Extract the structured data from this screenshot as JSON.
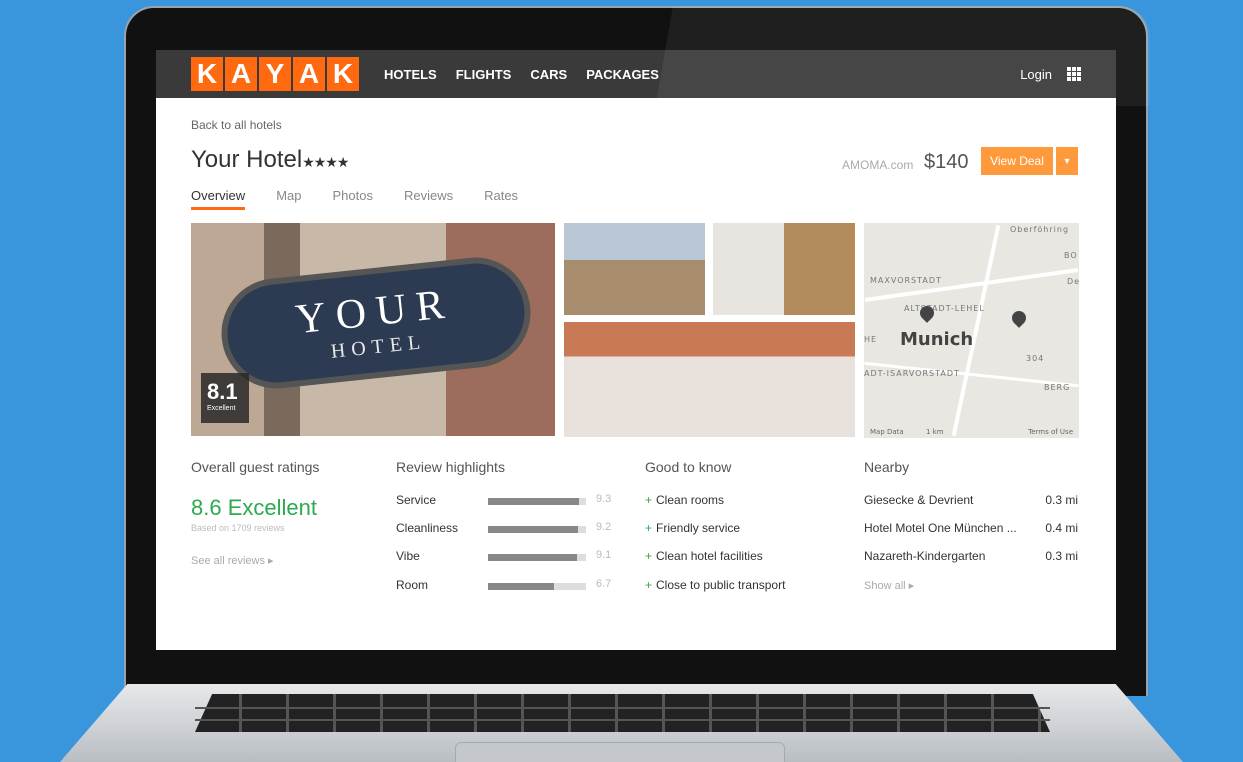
{
  "header": {
    "logo_letters": [
      "K",
      "A",
      "Y",
      "A",
      "K"
    ],
    "nav": [
      "HOTELS",
      "FLIGHTS",
      "CARS",
      "PACKAGES"
    ],
    "login": "Login"
  },
  "hotel": {
    "back_link": "Back to all hotels",
    "name": "Your Hotel",
    "stars": "★★★★",
    "provider": "AMOMA.com",
    "price": "$140",
    "deal_label": "View Deal",
    "deal_arrow": "▾"
  },
  "tabs": [
    "Overview",
    "Map",
    "Photos",
    "Reviews",
    "Rates"
  ],
  "photo": {
    "sign_top": "YOUR",
    "sign_bottom": "HOTEL",
    "score": "8.1",
    "score_label": "Excellent"
  },
  "map": {
    "labels": [
      "Oberföhring",
      "MAXVORSTADT",
      "ALTSTADT-LEHEL",
      "Munich",
      "ADT-ISARVORSTADT",
      "BERG",
      "BO",
      "De",
      "HE",
      "304"
    ],
    "footer_left": "Map Data",
    "footer_km": "1 km",
    "footer_right": "Terms of Use"
  },
  "ratings": {
    "heading": "Overall guest ratings",
    "score": "8.6 Excellent",
    "based_on": "Based on 1709 reviews",
    "see_all": "See all reviews ▸"
  },
  "highlights": {
    "heading": "Review highlights",
    "items": [
      {
        "label": "Service",
        "value": "9.3",
        "fraction": 0.93
      },
      {
        "label": "Cleanliness",
        "value": "9.2",
        "fraction": 0.92
      },
      {
        "label": "Vibe",
        "value": "9.1",
        "fraction": 0.91
      },
      {
        "label": "Room",
        "value": "6.7",
        "fraction": 0.67
      }
    ]
  },
  "good_to_know": {
    "heading": "Good to know",
    "items": [
      "Clean rooms",
      "Friendly service",
      "Clean hotel facilities",
      "Close to public transport"
    ]
  },
  "nearby": {
    "heading": "Nearby",
    "items": [
      {
        "name": "Giesecke & Devrient",
        "distance": "0.3 mi"
      },
      {
        "name": "Hotel Motel One München ...",
        "distance": "0.4 mi"
      },
      {
        "name": "Nazareth-Kindergarten",
        "distance": "0.3 mi"
      }
    ],
    "show_all": "Show all ▸"
  },
  "colors": {
    "brand_orange": "#ff690f",
    "deal_orange": "#ff9a3c",
    "score_green": "#2eaa4f",
    "background_blue": "#3a96dc"
  }
}
